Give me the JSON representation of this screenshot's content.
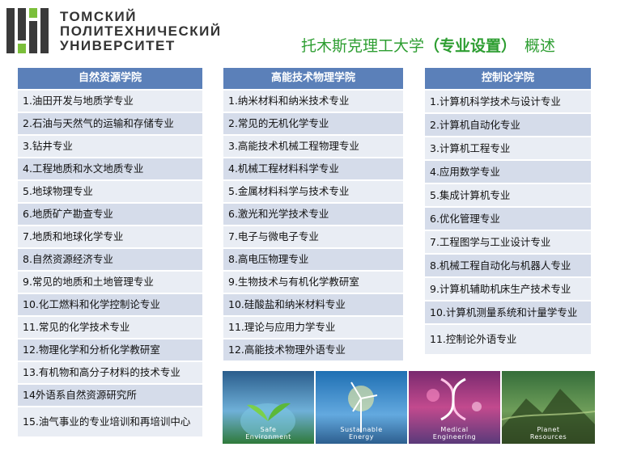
{
  "logo": {
    "lines": [
      "ТОМСКИЙ",
      "ПОЛИТЕХНИЧЕСКИЙ",
      "УНИВЕРСИТЕТ"
    ],
    "mark_colors": [
      "#3a3a3a",
      "#7bbf3a"
    ]
  },
  "title": {
    "main": "托木斯克理工大学",
    "highlight": "（专业设置）",
    "tail": "概述",
    "color": "#2e9e32"
  },
  "columns": [
    {
      "header": "自然资源学院",
      "items": [
        "1.油田开发与地质学专业",
        "2.石油与天然气的运输和存储专业",
        "3.钻井专业",
        "4.工程地质和水文地质专业",
        "5.地球物理专业",
        "6.地质矿产勘查专业",
        "7.地质和地球化学专业",
        "8.自然资源经济专业",
        "9.常见的地质和土地管理专业",
        "10.化工燃料和化学控制论专业",
        "11.常见的化学技术专业",
        "12.物理化学和分析化学教研室",
        "13.有机物和高分子材料的技术专业",
        "14外语系自然资源研究所",
        "15.油气事业的专业培训和再培训中心"
      ]
    },
    {
      "header": "高能技术物理学院",
      "items": [
        "1.纳米材料和纳米技术专业",
        "2.常见的无机化学专业",
        "3.高能技术机械工程物理专业",
        "4.机械工程材料科学专业",
        "5.金属材料科学与技术专业",
        "6.激光和光学技术专业",
        "7.电子与微电子专业",
        "8.高电压物理专业",
        "9.生物技术与有机化学教研室",
        "10.硅酸盐和纳米材料专业",
        "11.理论与应用力学专业",
        "12.高能技术物理外语专业"
      ]
    },
    {
      "header": "控制论学院",
      "items": [
        "1.计算机科学技术与设计专业",
        "2.计算机自动化专业",
        "3.计算机工程专业",
        "4.应用数学专业",
        "5.集成计算机专业",
        "6.优化管理专业",
        "7.工程图学与工业设计专业",
        "8.机械工程自动化与机器人专业",
        "9.计算机辅助机床生产技术专业",
        "10.计算机测量系统和计量学专业",
        "11.控制论外语专业"
      ]
    }
  ],
  "banner": [
    {
      "line1": "Safe",
      "line2": "Environment"
    },
    {
      "line1": "Sustainable",
      "line2": "Energy"
    },
    {
      "line1": "Medical",
      "line2": "Engineering"
    },
    {
      "line1": "Planet",
      "line2": "Resources"
    }
  ],
  "colors": {
    "header_bg": "#5b80b9",
    "row_bg": "#d5dcea",
    "row_bg_alt": "#e9edf4"
  }
}
